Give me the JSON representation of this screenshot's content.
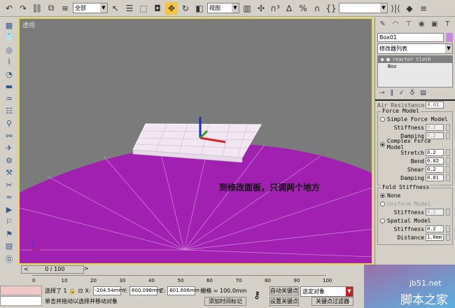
{
  "toolbar": {
    "selection_filter": "全部",
    "ref_coord": "视图",
    "named_sel": ""
  },
  "viewport": {
    "label": "透视",
    "overlay_text": "到修改面板，只调两个地方"
  },
  "command_panel": {
    "object_name": "Box01",
    "color": "#cc88dd",
    "modifier_list": "修改器列表",
    "stack": [
      "reactor Cloth",
      "Box"
    ],
    "air_resistance_label": "Air Resistance",
    "air_resistance": "0.01",
    "force_model": {
      "title": "Force Model",
      "simple": "Simple Force Model",
      "stiffness_label": "Stiffness",
      "stiffness": "0.2",
      "damping_label": "Damping",
      "damping": "0.2",
      "complex": "Complex Force Model",
      "stretch_label": "Stretch",
      "stretch": "0.2",
      "bend_label": "Bend",
      "bend": "0.02",
      "shear_label": "Shear",
      "shear": "0.2",
      "damping2_label": "Damping",
      "damping2": "0.01"
    },
    "fold": {
      "title": "Fold Stiffness",
      "none": "None",
      "uniform": "Uniform Model",
      "u_stiff_label": "Stiffness",
      "u_stiff": "0.2",
      "spatial": "Spatial Model",
      "s_stiff_label": "Stiffness",
      "s_stiff": "0.2",
      "distance_label": "Distance",
      "distance": "1.0mm"
    }
  },
  "timeline": {
    "frame": "0 / 100",
    "ticks": [
      "0",
      "10",
      "20",
      "30",
      "40",
      "50",
      "60",
      "70",
      "80",
      "90",
      "100"
    ]
  },
  "status": {
    "selected": "选择了 1",
    "x": "-204.54mm",
    "y": "600.098mm",
    "z": "601.606mm",
    "grid": "栅格 = 100.0mm",
    "auto_key": "自动关键点",
    "set_key": "设置关键点",
    "key_mode": "选定对象",
    "key_filters": "关键点过滤器",
    "prompt": "单击并拖动以选择并移动对象",
    "add_tag": "添加时间标记"
  },
  "watermark": {
    "domain": "jb51.net",
    "name": "脚本之家"
  }
}
